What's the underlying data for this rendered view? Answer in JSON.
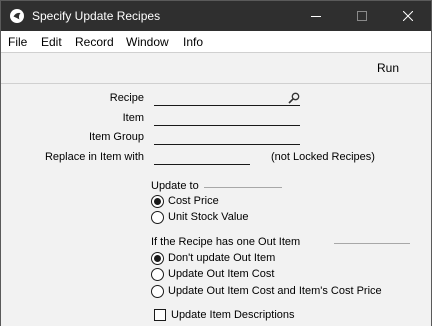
{
  "window": {
    "title": "Specify Update Recipes",
    "title_bar_color": "#2f2f2f"
  },
  "menu": {
    "items": [
      "File",
      "Edit",
      "Record",
      "Window",
      "Info"
    ]
  },
  "toolbar": {
    "run_label": "Run"
  },
  "form": {
    "recipe_label": "Recipe",
    "recipe_value": "",
    "item_label": "Item",
    "item_value": "",
    "item_group_label": "Item Group",
    "item_group_value": "",
    "replace_label": "Replace in Item with",
    "replace_value": "",
    "replace_note": "(not Locked Recipes)"
  },
  "update_to": {
    "title": "Update to",
    "options": [
      {
        "label": "Cost Price",
        "selected": true
      },
      {
        "label": "Unit Stock Value",
        "selected": false
      }
    ]
  },
  "out_item": {
    "title": "If the Recipe has one Out Item",
    "options": [
      {
        "label": "Don't update Out Item",
        "selected": true
      },
      {
        "label": "Update Out Item Cost",
        "selected": false
      },
      {
        "label": "Update Out Item Cost and Item's Cost Price",
        "selected": false
      }
    ]
  },
  "descriptions": {
    "label": "Update Item Descriptions",
    "checked": false
  }
}
